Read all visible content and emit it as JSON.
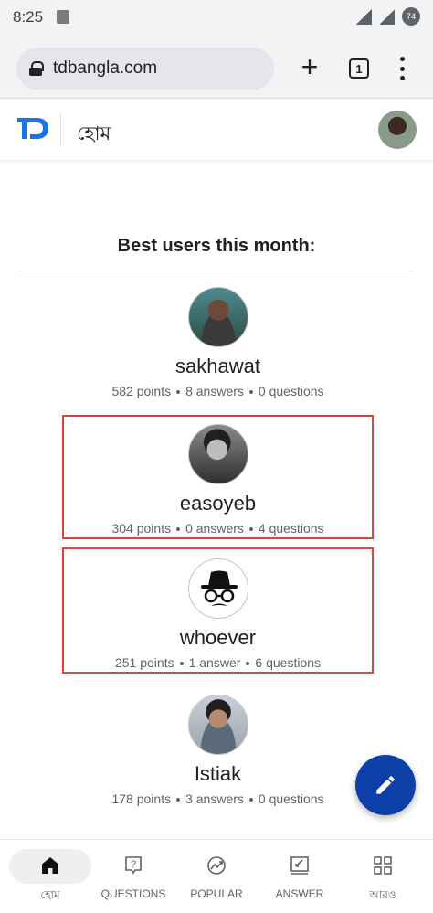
{
  "status_bar": {
    "time": "8:25",
    "battery": "74"
  },
  "browser": {
    "url": "tdbangla.com",
    "tab_count": "1"
  },
  "header": {
    "logo_text": "TD",
    "title": "হোম"
  },
  "section": {
    "title": "Best users this month:"
  },
  "users": [
    {
      "name": "sakhawat",
      "points": "582 points",
      "answers": "8 answers",
      "questions": "0 questions",
      "highlighted": false
    },
    {
      "name": "easoyeb",
      "points": "304 points",
      "answers": "0 answers",
      "questions": "4 questions",
      "highlighted": true
    },
    {
      "name": "whoever",
      "points": "251 points",
      "answers": "1 answer",
      "questions": "6 questions",
      "highlighted": true
    },
    {
      "name": "Istiak",
      "points": "178 points",
      "answers": "3 answers",
      "questions": "0 questions",
      "highlighted": false
    }
  ],
  "bottom_nav": [
    {
      "label": "হোম",
      "icon": "home-icon",
      "active": true
    },
    {
      "label": "QUESTIONS",
      "icon": "question-icon",
      "active": false
    },
    {
      "label": "POPULAR",
      "icon": "trending-icon",
      "active": false
    },
    {
      "label": "ANSWER",
      "icon": "answer-icon",
      "active": false
    },
    {
      "label": "আরও",
      "icon": "grid-icon",
      "active": false
    }
  ],
  "colors": {
    "accent": "#0d3fa8",
    "logo": "#1a73e8",
    "highlight_border": "#d9433a"
  }
}
